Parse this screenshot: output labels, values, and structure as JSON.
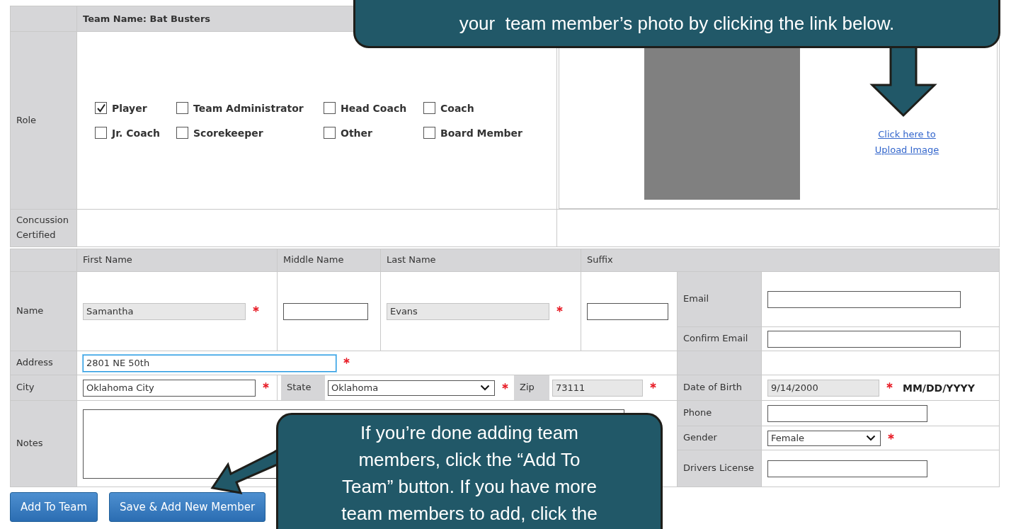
{
  "team_name": "Team Name: Bat Busters",
  "role": {
    "label": "Role",
    "options": [
      {
        "label": "Player",
        "checked": true
      },
      {
        "label": "Team Administrator",
        "checked": false
      },
      {
        "label": "Head Coach",
        "checked": false
      },
      {
        "label": "Coach",
        "checked": false
      },
      {
        "label": "Jr. Coach",
        "checked": false
      },
      {
        "label": "Scorekeeper",
        "checked": false
      },
      {
        "label": "Other",
        "checked": false
      },
      {
        "label": "Board Member",
        "checked": false
      }
    ]
  },
  "photo": {
    "upload_link": "Click here to Upload Image"
  },
  "concussion": {
    "label": "Concussion Certified"
  },
  "name_columns": [
    "First Name",
    "Middle Name",
    "Last Name",
    "Suffix"
  ],
  "name": {
    "label": "Name",
    "fields": [
      {
        "value": "Samantha",
        "required": true,
        "disabled": true
      },
      {
        "required": false,
        "disabled": false
      },
      {
        "value": "Evans",
        "required": true,
        "disabled": true
      },
      {
        "required": false,
        "disabled": false
      }
    ]
  },
  "email": {
    "label": "Email",
    "required": false,
    "disabled": false
  },
  "confirm_email": {
    "label": "Confirm Email",
    "required": false,
    "disabled": false
  },
  "address": {
    "label": "Address",
    "value": "2801 NE 50th",
    "required": true,
    "disabled": false,
    "focused": true
  },
  "city": {
    "label": "City",
    "value": "Oklahoma City",
    "required": true,
    "disabled": false,
    "focused": false
  },
  "state": {
    "label": "State",
    "value": "Oklahoma",
    "required": true
  },
  "zip": {
    "label": "Zip",
    "value": "73111",
    "required": true,
    "disabled": true
  },
  "date_of_birth": {
    "label": "Date of Birth",
    "value": "9/14/2000",
    "required": true,
    "disabled": true,
    "format_hint": "MM/DD/YYYY"
  },
  "notes": {
    "label": "Notes"
  },
  "phone": {
    "label": "Phone",
    "required": false,
    "disabled": false
  },
  "gender": {
    "label": "Gender",
    "value": "Female",
    "required": true
  },
  "drivers_license": {
    "label": "Drivers License",
    "required": false,
    "disabled": false
  },
  "buttons": [
    "Add To Team",
    "Save & Add New Member"
  ],
  "callouts": [
    {
      "kind": "top",
      "text": "your  team member’s photo by clicking the link below."
    },
    {
      "kind": "bottom",
      "text": "If you’re done adding team\nmembers, click the “Add To\nTeam” button. If you have more\nteam members to add, click the"
    }
  ]
}
